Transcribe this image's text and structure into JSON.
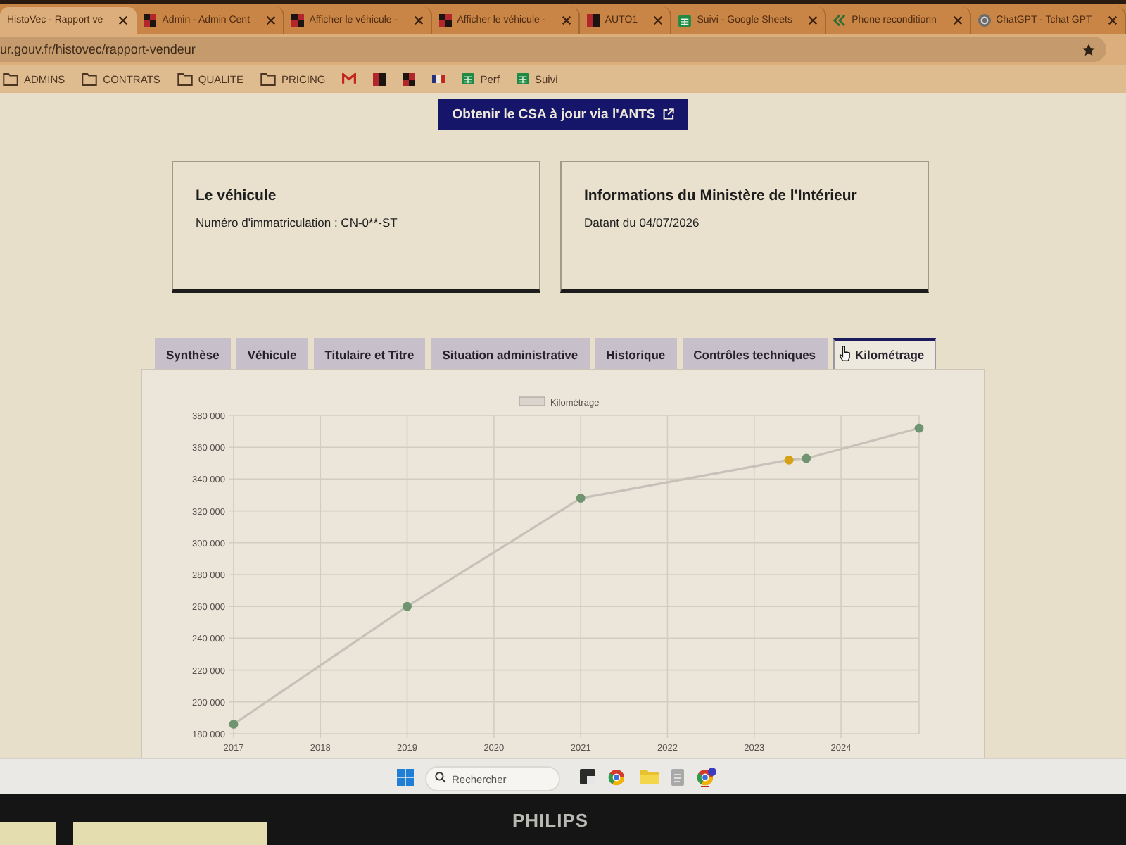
{
  "browser": {
    "tabs": [
      {
        "title": "HistoVec - Rapport ve",
        "kind": "none",
        "selected": true
      },
      {
        "title": "Admin - Admin Cent",
        "kind": "checker",
        "selected": false
      },
      {
        "title": "Afficher le véhicule -",
        "kind": "checker",
        "selected": false
      },
      {
        "title": "Afficher le véhicule -",
        "kind": "checker",
        "selected": false
      },
      {
        "title": "AUTO1",
        "kind": "split",
        "selected": false
      },
      {
        "title": "Suivi - Google Sheets",
        "kind": "sheet",
        "selected": false
      },
      {
        "title": "Phone reconditionn",
        "kind": "chevrons",
        "selected": false
      },
      {
        "title": "ChatGPT - Tchat GPT",
        "kind": "bot",
        "selected": false
      }
    ],
    "address": {
      "url": "ur.gouv.fr/histovec/rapport-vendeur"
    },
    "bookmarks": [
      {
        "label": "ADMINS",
        "kind": "folder"
      },
      {
        "label": "CONTRATS",
        "kind": "folder"
      },
      {
        "label": "QUALITE",
        "kind": "folder"
      },
      {
        "label": "PRICING",
        "kind": "folder"
      },
      {
        "kind": "mail"
      },
      {
        "kind": "split"
      },
      {
        "kind": "checker"
      },
      {
        "kind": "flag"
      },
      {
        "label": "Perf",
        "kind": "sheet"
      },
      {
        "label": "Suivi",
        "kind": "sheet"
      }
    ]
  },
  "page": {
    "csa_button": {
      "label": "Obtenir le CSA à jour via l'ANTS"
    },
    "cards": [
      {
        "title": "Le véhicule",
        "text": "Numéro d'immatriculation : CN-0**-ST"
      },
      {
        "title": "Informations du Ministère de l'Intérieur",
        "text": "Datant du 04/07/2026"
      }
    ],
    "tabs": [
      {
        "label": "Synthèse",
        "selected": false
      },
      {
        "label": "Véhicule",
        "selected": false
      },
      {
        "label": "Titulaire et Titre",
        "selected": false
      },
      {
        "label": "Situation administrative",
        "selected": false
      },
      {
        "label": "Historique",
        "selected": false
      },
      {
        "label": "Contrôles techniques",
        "selected": false
      },
      {
        "label": "Kilométrage",
        "selected": true
      }
    ],
    "chart_panel": {
      "chart_data": {
        "type": "line",
        "grid": true,
        "x": [
          2017,
          2019,
          2021,
          2023.4,
          2023.6,
          2024.9
        ],
        "xlim": [
          2017,
          2024.9
        ],
        "ylim": [
          180000,
          380000
        ],
        "xticks": [
          2017,
          2018,
          2019,
          2020,
          2021,
          2022,
          2023,
          2024
        ],
        "yticks": [
          {
            "value": 180000,
            "label": "180 000"
          },
          {
            "value": 200000,
            "label": "200 000"
          },
          {
            "value": 220000,
            "label": "220 000"
          },
          {
            "value": 240000,
            "label": "240 000"
          },
          {
            "value": 260000,
            "label": "260 000"
          },
          {
            "value": 280000,
            "label": "280 000"
          },
          {
            "value": 300000,
            "label": "300 000"
          },
          {
            "value": 320000,
            "label": "320 000"
          },
          {
            "value": 340000,
            "label": "340 000"
          },
          {
            "value": 360000,
            "label": "360 000"
          },
          {
            "value": 380000,
            "label": "380 000"
          }
        ],
        "series": [
          {
            "name": "Kilométrage",
            "color": "#6f9470",
            "marker": "circle",
            "values": [
              186000,
              260000,
              328000,
              352000,
              353000,
              372000
            ]
          },
          {
            "color": "#d6a015",
            "marker": "circle",
            "values": [
              null,
              null,
              null,
              352000,
              null,
              null
            ]
          }
        ]
      }
    }
  },
  "taskbar": {
    "search": {
      "placeholder": "Rechercher"
    },
    "apps": [
      {
        "kind": "tile"
      },
      {
        "kind": "wheel"
      },
      {
        "kind": "folder"
      },
      {
        "kind": "notepad"
      },
      {
        "kind": "wheel-badge"
      }
    ]
  },
  "monitor": {
    "brand": "PHILIPS"
  }
}
